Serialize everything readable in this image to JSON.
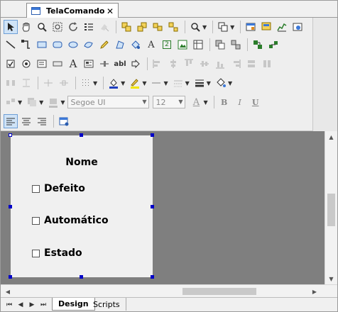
{
  "document_tab": {
    "title": "TelaComando",
    "close_glyph": "✕"
  },
  "toolbar": {
    "font_name": "Segoe UI",
    "font_size": "12",
    "bold_label": "B",
    "italic_label": "I",
    "underline_label": "U",
    "text_tool_label": "A",
    "numeric_tool_label": "2",
    "abl_tool_label": "abl",
    "font_color_label": "A"
  },
  "form": {
    "title": "Nome",
    "checkboxes": [
      {
        "label": "Defeito",
        "checked": false
      },
      {
        "label": "Automático",
        "checked": false
      },
      {
        "label": "Estado",
        "checked": false
      }
    ]
  },
  "bottom_tabs": {
    "design": "Design",
    "scripts": "Scripts"
  },
  "colors": {
    "canvas": "#f0f0f0",
    "workspace": "#7f7f7f",
    "handle": "#0000c8",
    "accent": "#3b78d8"
  }
}
